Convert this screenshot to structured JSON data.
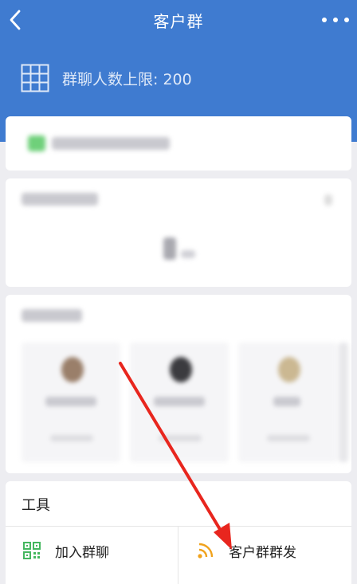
{
  "nav": {
    "title": "客户群"
  },
  "group": {
    "limit_text": "群聊人数上限: 200"
  },
  "tools": {
    "title": "工具",
    "items": [
      {
        "label": "加入群聊",
        "icon": "qr-code-icon",
        "color": "#45b75f"
      },
      {
        "label": "客户群群发",
        "icon": "broadcast-icon",
        "color": "#f0a21c"
      }
    ]
  },
  "colors": {
    "header": "#3f7bd0",
    "annotation_arrow": "#e8261e"
  }
}
